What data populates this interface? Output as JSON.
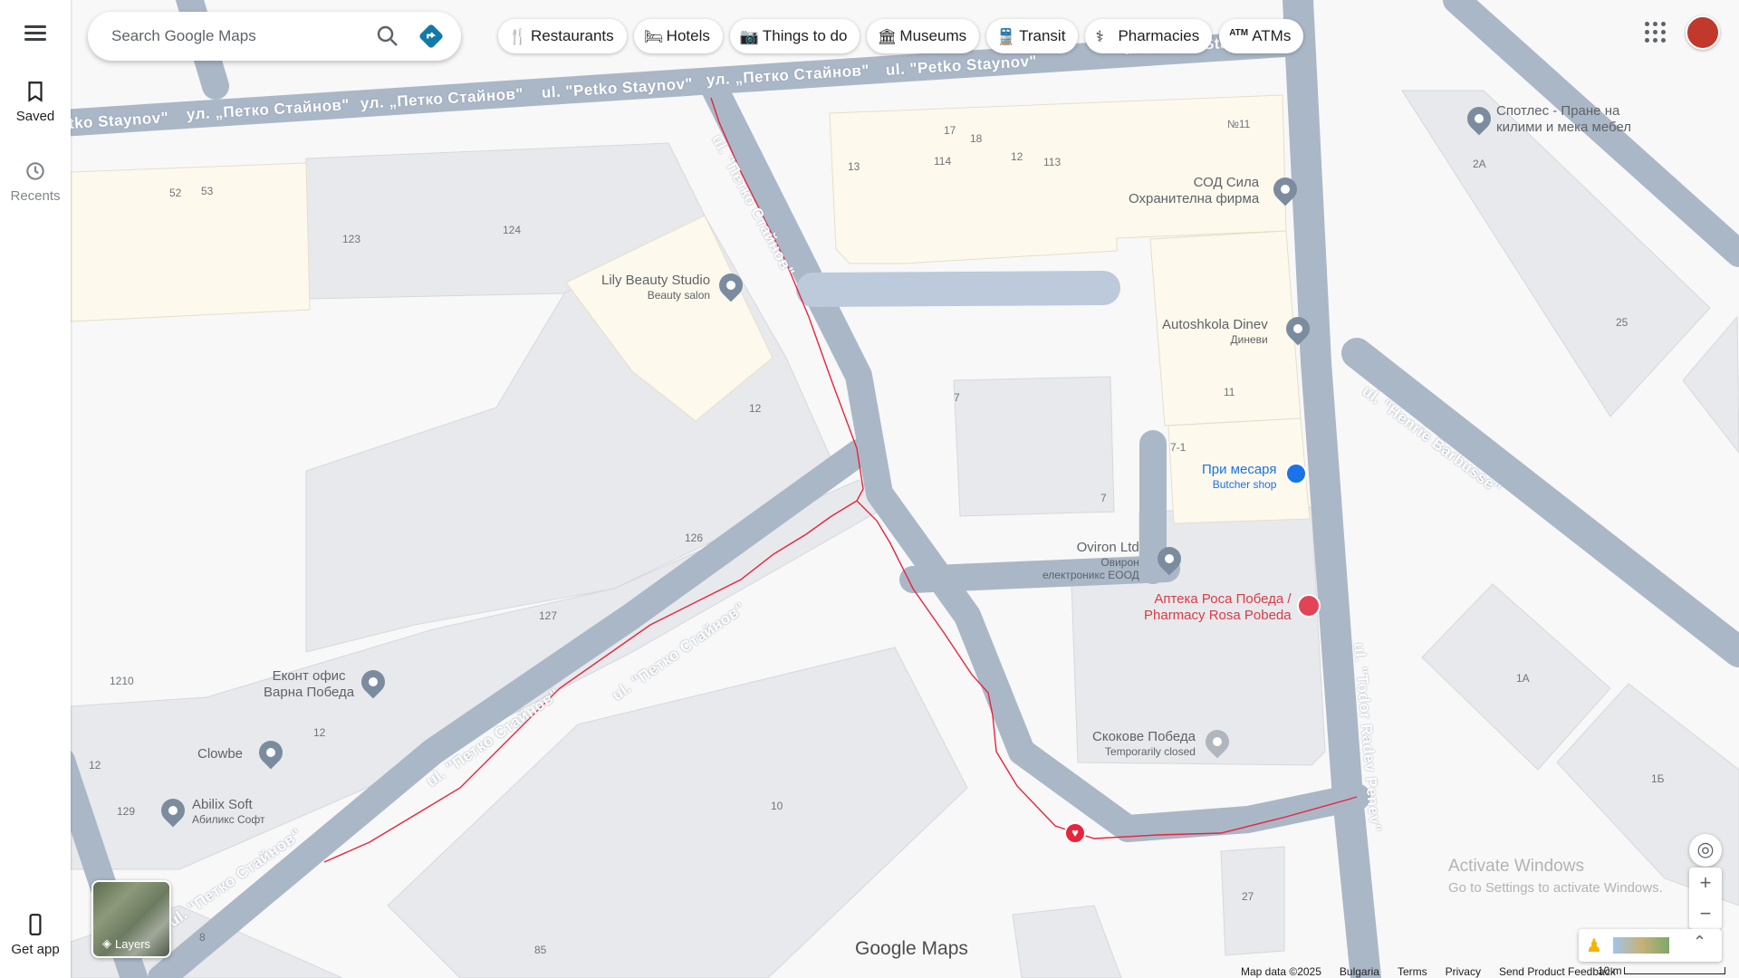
{
  "search": {
    "placeholder": "Search Google Maps"
  },
  "chips": [
    {
      "label": "Restaurants",
      "icon": "restaurant-icon"
    },
    {
      "label": "Hotels",
      "icon": "hotel-icon"
    },
    {
      "label": "Things to do",
      "icon": "camera-icon"
    },
    {
      "label": "Museums",
      "icon": "museum-icon"
    },
    {
      "label": "Transit",
      "icon": "transit-icon"
    },
    {
      "label": "Pharmacies",
      "icon": "pharmacy-icon"
    },
    {
      "label": "ATMs",
      "icon": "atm-icon"
    }
  ],
  "rail": {
    "saved": "Saved",
    "recents": "Recents",
    "get_app": "Get app"
  },
  "layers_label": "Layers",
  "brand": "Google Maps",
  "watermark": {
    "line1": "Activate Windows",
    "line2": "Go to Settings to activate Windows."
  },
  "footer": {
    "map_data": "Map data ©2025",
    "country": "Bulgaria",
    "terms": "Terms",
    "privacy": "Privacy",
    "feedback": "Send Product Feedback",
    "scale": "10 m"
  },
  "streets": {
    "s1": "ul. \"Petko Staynov\"",
    "s1b": "tko Staynov\"",
    "s2": "ул. „Петко Стайнов\"",
    "s3": "ул. „Петко Стайнов\"",
    "s4": "ul. \"Petko Staynov\"",
    "s5": "ул. „Петко Стайнов\"",
    "s6": "ul. \"Petko Staynov\"",
    "s7": "ul. \"Petko Staynov\"",
    "v1": "ul. \"Петко Стайнов\"",
    "d1": "ul. \"Петко Стайнов\"",
    "d2": "ul. \"Петко Стайнов\"",
    "d3": "ul. \"Петко Стайнов\"",
    "d4": "ul. \"Петко Стайнов\"",
    "barbusse": "ul. \"Henrie Barbusse\"",
    "radev": "ul. \"Todor Radev Penev\""
  },
  "places": {
    "lily": {
      "name": "Lily Beauty Studio",
      "sub": "Beauty salon"
    },
    "sod": {
      "name": "СОД Сила",
      "sub": "Охранителна фирма"
    },
    "autoshkola": {
      "name": "Autoshkola Dinev",
      "sub": "Диневи"
    },
    "mesarya": {
      "name": "При месаря",
      "sub": "Butcher shop"
    },
    "oviron": {
      "name": "Oviron Ltd",
      "sub1": "Овирон",
      "sub2": "електроникс ЕООД"
    },
    "apteka": {
      "name1": "Аптека Роса Победа /",
      "name2": "Pharmacy Rosa Pobeda"
    },
    "skokove": {
      "name": "Скокове Победа",
      "sub": "Temporarily closed"
    },
    "ekont": {
      "name1": "Еконт офис",
      "name2": "Варна Победа"
    },
    "clowbe": {
      "name": "Clowbe"
    },
    "abilix": {
      "name": "Abilix Soft",
      "sub": "Абиликс Софт"
    },
    "spotles": {
      "name1": "Спотлес - Пране на",
      "name2": "килими и мека мебел"
    }
  },
  "numbers": {
    "n52": "52",
    "n53": "53",
    "n123": "123",
    "n124": "124",
    "n17": "17",
    "n18": "18",
    "n12a": "12",
    "n13": "13",
    "n114": "114",
    "n113": "113",
    "n11a": "№11",
    "n2a": "2А",
    "n25": "25",
    "n11": "11",
    "n7a": "7",
    "n7b": "7",
    "n71": "7-1",
    "n12b": "12",
    "n126": "126",
    "n127": "127",
    "n1210": "1210",
    "n12c": "12",
    "n12d": "12",
    "n129": "129",
    "n10": "10",
    "n1a": "1А",
    "n1b": "1Б",
    "n27": "27",
    "n8": "8",
    "n85": "85"
  },
  "colors": {
    "road": "#aab7c7",
    "building": "#e8e9ec",
    "beige": "#fdf9ec",
    "route": "#e8243c",
    "pharmacy": "#e34356",
    "butcher": "#1a73e8"
  }
}
